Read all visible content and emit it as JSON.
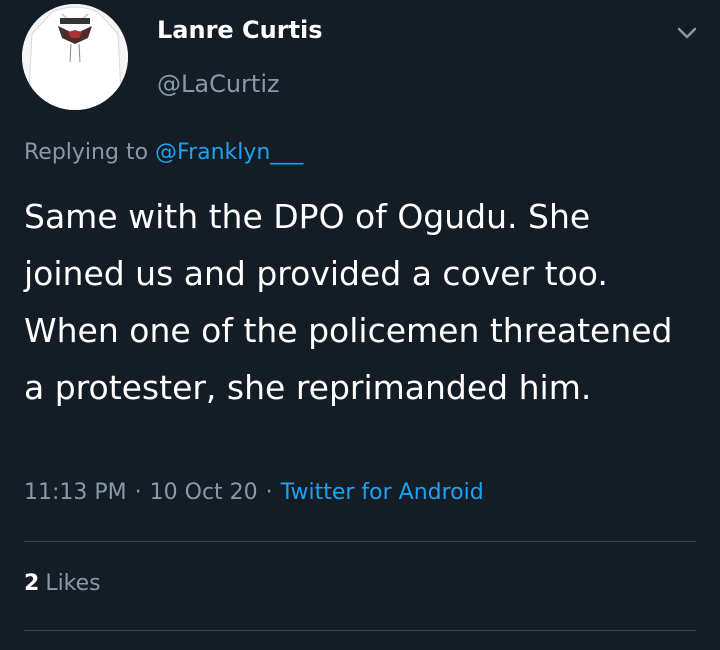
{
  "author": {
    "display_name": "Lanre Curtis",
    "handle": "@LaCurtiz",
    "avatar_icon": "avatar-hoodie-photo"
  },
  "menu": {
    "icon": "chevron-down-icon"
  },
  "reply": {
    "prefix": "Replying to",
    "mention": "@Franklyn___"
  },
  "tweet": {
    "text": "Same with the DPO of Ogudu. She joined us and provided a cover too. When one of the policemen threatened a protester, she reprimanded him."
  },
  "meta": {
    "time": "11:13 PM",
    "separator": "·",
    "date": "10 Oct 20",
    "source": "Twitter for Android"
  },
  "stats": {
    "likes_count": "2",
    "likes_label": "Likes"
  },
  "colors": {
    "background": "#141d26",
    "accent": "#1da1f2",
    "secondary_text": "#8899a6",
    "divider": "#38444d"
  }
}
